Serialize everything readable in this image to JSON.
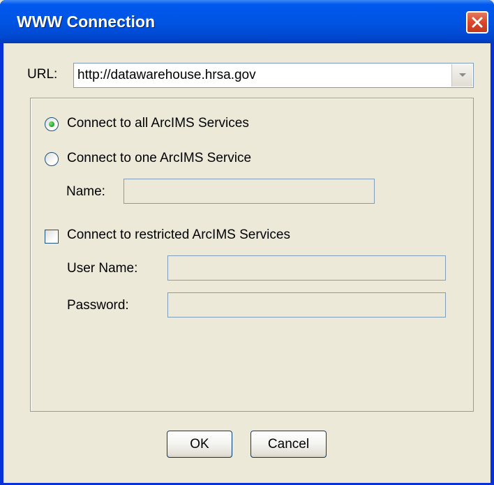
{
  "window": {
    "title": "WWW Connection"
  },
  "url": {
    "label": "URL:",
    "value": "http://datawarehouse.hrsa.gov"
  },
  "options": {
    "all_services": {
      "label": "Connect to all ArcIMS Services",
      "selected": true
    },
    "one_service": {
      "label": "Connect to one ArcIMS Service",
      "selected": false
    },
    "name_label": "Name:",
    "name_value": "",
    "restricted": {
      "label": "Connect to restricted ArcIMS Services",
      "checked": false
    },
    "username_label": "User Name:",
    "username_value": "",
    "password_label": "Password:",
    "password_value": ""
  },
  "buttons": {
    "ok": "OK",
    "cancel": "Cancel"
  },
  "colors": {
    "titlebar": "#0054e3",
    "close": "#d9472b",
    "dialog_bg": "#ece9d8",
    "radio_selected": "#21a121"
  },
  "icons": {
    "close": "close-icon",
    "dropdown": "chevron-down-icon"
  }
}
